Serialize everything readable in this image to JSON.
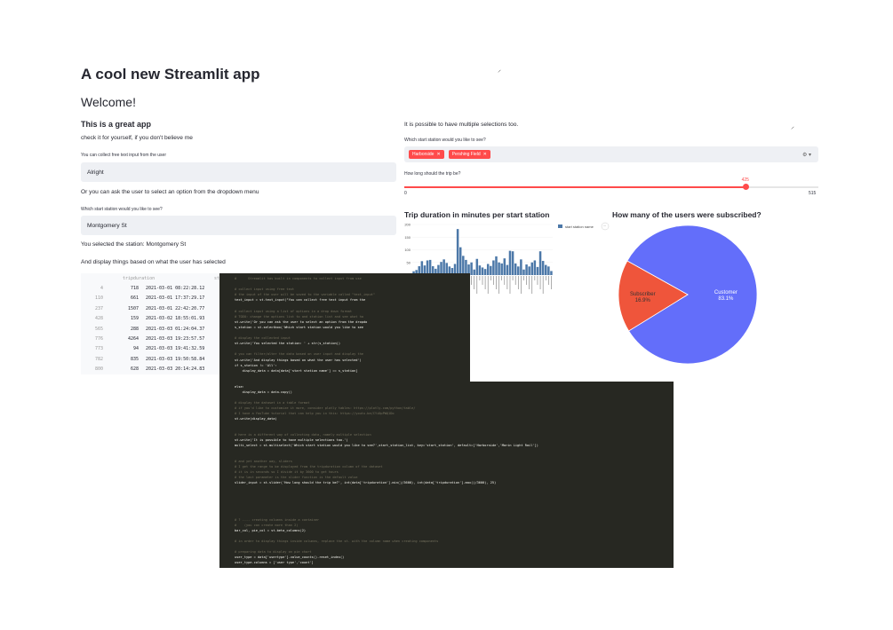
{
  "header": {
    "title": "A cool new Streamlit app",
    "welcome": "Welcome!",
    "subheading": "This is a great app",
    "tagline": "check it for yourself, if you don't believe me"
  },
  "text_input": {
    "label": "You can collect free text input from the user",
    "value": "Alright"
  },
  "dropdown_intro": "Or you can ask the user to select an option from the dropdown menu",
  "station_select": {
    "label": "Which start station would you like to see?",
    "value": "Montgomery St"
  },
  "selected_text": "You selected the station: Montgomery St",
  "display_text": "And display things based on what the user has selected",
  "table": {
    "columns": [
      "tripduration",
      "startt"
    ],
    "rows": [
      {
        "index": "4",
        "tripduration": "718",
        "starttime": "2021-03-01 08:22:28.12"
      },
      {
        "index": "110",
        "tripduration": "661",
        "starttime": "2021-03-01 17:37:29.17"
      },
      {
        "index": "237",
        "tripduration": "1507",
        "starttime": "2021-03-01 22:42:20.77"
      },
      {
        "index": "428",
        "tripduration": "159",
        "starttime": "2021-03-02 18:55:01.93"
      },
      {
        "index": "565",
        "tripduration": "288",
        "starttime": "2021-03-03 01:24:04.37"
      },
      {
        "index": "776",
        "tripduration": "4264",
        "starttime": "2021-03-03 19:23:57.57"
      },
      {
        "index": "773",
        "tripduration": "94",
        "starttime": "2021-03-03 19:41:32.59"
      },
      {
        "index": "782",
        "tripduration": "835",
        "starttime": "2021-03-03 19:50:58.84"
      },
      {
        "index": "800",
        "tripduration": "628",
        "starttime": "2021-03-03 20:14:24.83"
      }
    ]
  },
  "multiselect": {
    "intro": "It is possible to have multiple selections too.",
    "label": "Which start station would you like to see?",
    "tags": [
      "Harborside",
      "Pershing Field"
    ]
  },
  "slider": {
    "label": "How long should the trip be?",
    "value": "425",
    "min": "0",
    "max": "515",
    "value_num": 425,
    "max_num": 515
  },
  "bar_chart": {
    "title": "Trip duration in minutes per start station",
    "legend": "start station name"
  },
  "pie_chart": {
    "title": "How many of the users were subscribed?"
  },
  "chart_data": [
    {
      "type": "bar",
      "title": "Trip duration in minutes per start station",
      "ylim": [
        0,
        200
      ],
      "yticks": [
        "200",
        "150",
        "100",
        "50",
        "0"
      ],
      "legend": "start station name",
      "values": [
        15,
        20,
        35,
        55,
        38,
        58,
        60,
        35,
        25,
        40,
        52,
        62,
        48,
        34,
        28,
        44,
        182,
        110,
        76,
        60,
        42,
        50,
        22,
        64,
        38,
        30,
        24,
        44,
        36,
        58,
        74,
        50,
        46,
        66,
        40,
        96,
        94,
        46,
        34,
        62,
        22,
        42,
        34,
        50,
        58,
        32,
        94,
        56,
        40,
        34,
        16
      ]
    },
    {
      "type": "pie",
      "title": "How many of the users were subscribed?",
      "labels": [
        "Customer",
        "Subscriber"
      ],
      "values": [
        83.1,
        16.9
      ],
      "display": [
        "83.1%",
        "16.9%"
      ],
      "colors": [
        "#636efa",
        "#ef553b"
      ]
    }
  ],
  "code1": [
    {
      "t": "#      Streamlit has built in components to collect input from use",
      "c": "cm"
    },
    {
      "t": "",
      "c": ""
    },
    {
      "t": "# collect input using free text",
      "c": "cm"
    },
    {
      "t": "# the input of the user will be saved to the variable called \"text_input\"",
      "c": "cm"
    },
    {
      "t": "text_input = st.text_input(\"You can collect free text input from the",
      "c": ""
    },
    {
      "t": "",
      "c": ""
    },
    {
      "t": "# collect input using a list of options in a drop down format",
      "c": "cm"
    },
    {
      "t": "# TODO: change the options list to and station list and see what ha",
      "c": "cm"
    },
    {
      "t": "st.write('Or you can ask the user to select an option from the dropdo",
      "c": ""
    },
    {
      "t": "s_station = st.selectbox('Which start station would you like to see",
      "c": ""
    },
    {
      "t": "",
      "c": ""
    },
    {
      "t": "# display the collected input",
      "c": "cm"
    },
    {
      "t": "st.write('You selected the station: ' + str(s_station))",
      "c": ""
    },
    {
      "t": "",
      "c": ""
    },
    {
      "t": "# you can filter/alter the data based on user input and display the",
      "c": "cm"
    },
    {
      "t": "st.write('And display things based on what the user has selected')",
      "c": ""
    },
    {
      "t": "if s_station != 'All':",
      "c": ""
    },
    {
      "t": "    display_data = data[data['start station name'] == s_station]",
      "c": ""
    }
  ],
  "code2": [
    {
      "t": "else:",
      "c": ""
    },
    {
      "t": "    display_data = data.copy()",
      "c": ""
    },
    {
      "t": "",
      "c": ""
    },
    {
      "t": "# display the dataset in a table format",
      "c": "cm"
    },
    {
      "t": "# if you'd like to customize it more, consider plotly tables: https://plotly.com/python/table/",
      "c": "cm"
    },
    {
      "t": "# I have a YouTube tutorial that can help you in this: https://youtu.be/CYi0pPWQ1Do",
      "c": "cm"
    },
    {
      "t": "st.write(display_data)",
      "c": ""
    },
    {
      "t": "",
      "c": ""
    },
    {
      "t": "",
      "c": ""
    },
    {
      "t": "# here is a different way of collecting data, namely multiple selection",
      "c": "cm"
    },
    {
      "t": "st.write('It is possible to have multiple selections too.')",
      "c": ""
    },
    {
      "t": "multi_select = st.multiselect('Which start station would you like to see?',start_station_list, key='start_station', default=['Harborside','Marin Light Rail'])",
      "c": ""
    },
    {
      "t": "",
      "c": ""
    },
    {
      "t": "",
      "c": ""
    },
    {
      "t": "# and yet another way, sliders",
      "c": "cm"
    },
    {
      "t": "# I get the range to be displayed from the tripduration column of the dataset",
      "c": "cm"
    },
    {
      "t": "# it is in seconds so I divide it by 3600 to get hours",
      "c": "cm"
    },
    {
      "t": "# the last parameter is the slider function is the default value",
      "c": "cm"
    },
    {
      "t": "slider_input = st.slider('How long should the trip be?', int(data['tripduration'].min()/3600), int(data['tripduration'].max()/3600), 25)",
      "c": ""
    },
    {
      "t": "",
      "c": ""
    },
    {
      "t": "",
      "c": ""
    },
    {
      "t": "",
      "c": ""
    },
    {
      "t": "",
      "c": ""
    },
    {
      "t": "",
      "c": ""
    },
    {
      "t": "",
      "c": ""
    },
    {
      "t": "# ? ---- creating columns inside a container",
      "c": "cm"
    },
    {
      "t": "#    (you can create more than 2)",
      "c": "cm"
    },
    {
      "t": "bar_col, pie_col = st.beta_columns(2)",
      "c": ""
    },
    {
      "t": "",
      "c": ""
    },
    {
      "t": "# in order to display things inside columns, replace the st. with the column name when creating components",
      "c": "cm"
    },
    {
      "t": "",
      "c": ""
    },
    {
      "t": "# preparing data to display on pie chart",
      "c": "cm"
    },
    {
      "t": "user_type = data['usertype'].value_counts().reset_index()",
      "c": ""
    },
    {
      "t": "user_type.columns = ['user type','count']",
      "c": ""
    }
  ]
}
